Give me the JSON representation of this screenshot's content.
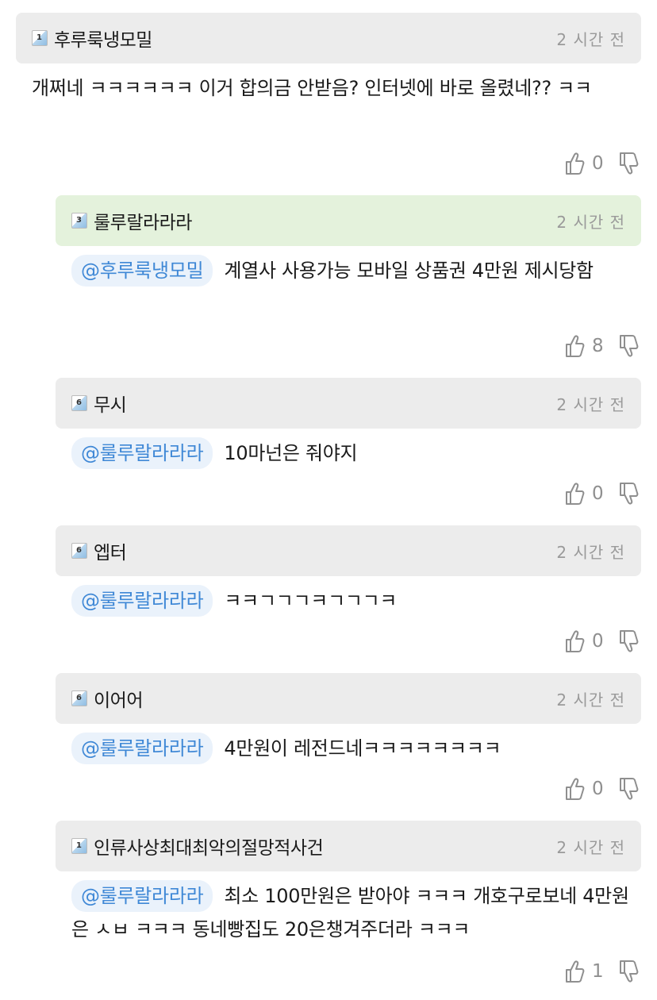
{
  "comments": [
    {
      "level": "1",
      "username": "후루룩냉모밀",
      "time": "2 시간 전",
      "mention": "",
      "text": "개쩌네 ㅋㅋㅋㅋㅋㅋ 이거 합의금 안받음? 인터넷에 바로 올렸네?? ㅋㅋ",
      "likes": "0"
    },
    {
      "level": "3",
      "username": "룰루랄라라라",
      "time": "2 시간 전",
      "mention": "@후루룩냉모밀",
      "text": "계열사 사용가능 모바일 상품권 4만원 제시당함",
      "likes": "8"
    },
    {
      "level": "6",
      "username": "무시",
      "time": "2 시간 전",
      "mention": "@룰루랄라라라",
      "text": "10마넌은 줘야지",
      "likes": "0"
    },
    {
      "level": "6",
      "username": "엡터",
      "time": "2 시간 전",
      "mention": "@룰루랄라라라",
      "text": "ㅋㅋㄱㄱㄱㅋㄱㄱㄱㅋ",
      "likes": "0"
    },
    {
      "level": "6",
      "username": "이어어",
      "time": "2 시간 전",
      "mention": "@룰루랄라라라",
      "text": "4만원이 레전드네ㅋㅋㅋㅋㅋㅋㅋㅋ",
      "likes": "0"
    },
    {
      "level": "1",
      "username": "인류사상최대최악의절망적사건",
      "time": "2 시간 전",
      "mention": "@룰루랄라라라",
      "text": "최소 100만원은 받아야 ㅋㅋㅋ 개호구로보네 4만원은 ㅅㅂ ㅋㅋㅋ 동네빵집도 20은챙겨주더라 ㅋㅋㅋ",
      "likes": "1"
    }
  ],
  "colors": {
    "highlight_header": "#e4f2dc",
    "header": "#ececec",
    "mention": "#3f88d6"
  },
  "icons": {
    "like": "thumbs-up-icon",
    "dislike": "thumbs-down-icon",
    "level": "level-badge-icon"
  }
}
